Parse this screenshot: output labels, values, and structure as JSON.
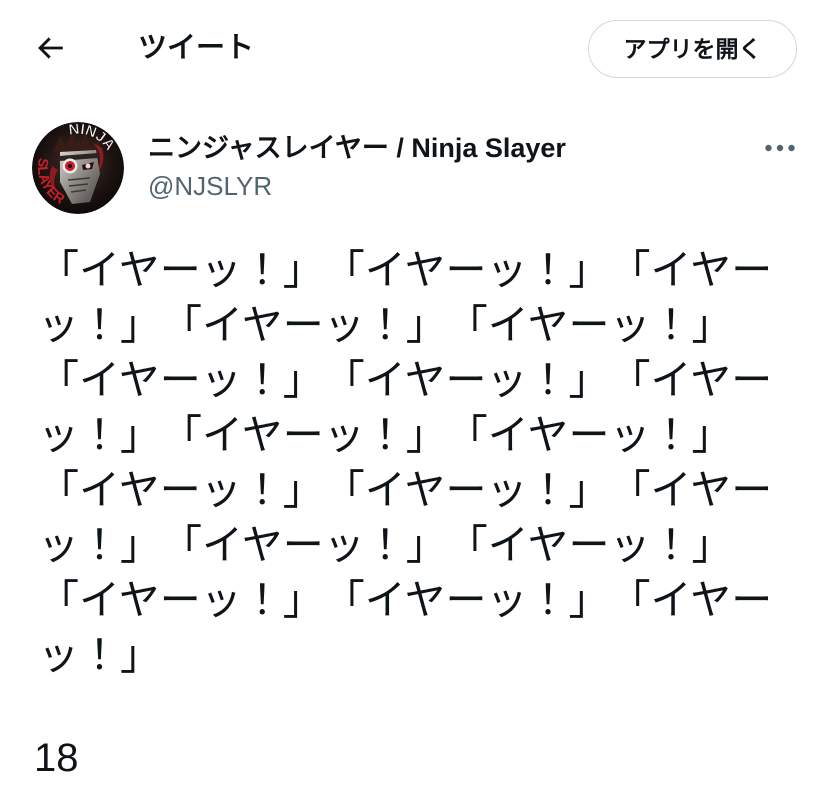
{
  "colors": {
    "background": "#ffffff",
    "text_primary": "#0f1419",
    "text_secondary": "#536471",
    "button_border": "#cfd9de",
    "avatar_accent_red": "#c8202a"
  },
  "icons": {
    "back": "arrow-left-icon",
    "more": "more-horizontal-icon"
  },
  "header": {
    "title": "ツイート",
    "open_app_label": "アプリを開く"
  },
  "tweet": {
    "author": {
      "display_name": "ニンジャスレイヤー / Ninja Slayer",
      "handle": "@NJSLYR",
      "avatar_logo": {
        "top_text": "NINJA",
        "bottom_text": "SLAYER"
      }
    },
    "text": "「イヤーッ！」「イヤーッ！」「イヤーッ！」「イヤーッ！」「イヤーッ！」「イヤーッ！」「イヤーッ！」「イヤーッ！」「イヤーッ！」「イヤーッ！」「イヤーッ！」「イヤーッ！」「イヤーッ！」「イヤーッ！」「イヤーッ！」「イヤーッ！」「イヤーッ！」「イヤーッ！」",
    "count": "18"
  }
}
